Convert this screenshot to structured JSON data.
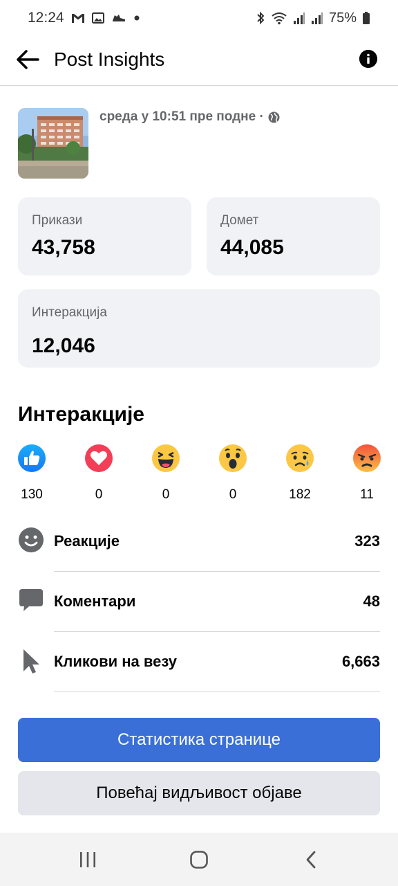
{
  "status_bar": {
    "time": "12:24",
    "battery": "75%"
  },
  "header": {
    "title": "Post Insights"
  },
  "post": {
    "meta": "среда у 10:51 пре подне ·"
  },
  "stats": {
    "impressions": {
      "label": "Прикази",
      "value": "43,758"
    },
    "reach": {
      "label": "Домет",
      "value": "44,085"
    },
    "engagement": {
      "label": "Интеракција",
      "value": "12,046"
    }
  },
  "interactions": {
    "title": "Интеракције",
    "reactions": [
      {
        "icon": "like-icon",
        "count": "130"
      },
      {
        "icon": "love-icon",
        "count": "0"
      },
      {
        "icon": "haha-icon",
        "count": "0"
      },
      {
        "icon": "wow-icon",
        "count": "0"
      },
      {
        "icon": "sad-icon",
        "count": "182"
      },
      {
        "icon": "angry-icon",
        "count": "11"
      }
    ],
    "metrics": [
      {
        "icon": "smiley-icon",
        "label": "Реакције",
        "value": "323"
      },
      {
        "icon": "comment-icon",
        "label": "Коментари",
        "value": "48"
      },
      {
        "icon": "cursor-icon",
        "label": "Кликови на везу",
        "value": "6,663"
      }
    ]
  },
  "buttons": {
    "page_insights": "Статистика странице",
    "boost_post": "Повећај видљивост објаве"
  },
  "colors": {
    "primary": "#3a6fd8",
    "card_bg": "#f0f2f5",
    "secondary_text": "#65676b"
  }
}
